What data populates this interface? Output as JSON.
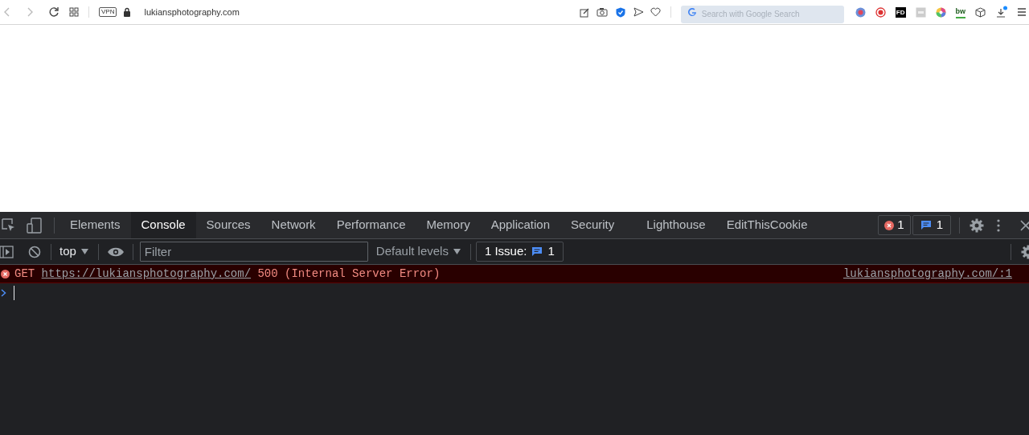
{
  "browser": {
    "vpn_label": "VPN",
    "url": "lukiansphotography.com",
    "search_placeholder": "Search with Google Search",
    "extensions": [
      {
        "kind": "dot"
      },
      {
        "kind": "record"
      },
      {
        "kind": "text",
        "label": "FD"
      },
      {
        "kind": "square"
      },
      {
        "kind": "wheel"
      },
      {
        "kind": "text2",
        "label": "bw"
      },
      {
        "kind": "cube"
      },
      {
        "kind": "download"
      }
    ]
  },
  "devtools": {
    "tabs": [
      {
        "label": "Elements",
        "selected": false
      },
      {
        "label": "Console",
        "selected": true
      },
      {
        "label": "Sources",
        "selected": false
      },
      {
        "label": "Network",
        "selected": false
      },
      {
        "label": "Performance",
        "selected": false
      },
      {
        "label": "Memory",
        "selected": false
      },
      {
        "label": "Application",
        "selected": false
      },
      {
        "label": "Security",
        "selected": false
      },
      {
        "label": "Lighthouse",
        "selected": false
      },
      {
        "label": "EditThisCookie",
        "selected": false
      }
    ],
    "error_count": "1",
    "message_count": "1",
    "console_toolbar": {
      "context": "top",
      "filter_placeholder": "Filter",
      "levels": "Default levels",
      "issues_label": "1 Issue:",
      "issues_count": "1"
    },
    "messages": [
      {
        "kind": "error",
        "method": "GET",
        "url": "https://lukiansphotography.com/",
        "status": "500 (Internal Server Error)",
        "source": "lukiansphotography.com/:1"
      }
    ]
  }
}
